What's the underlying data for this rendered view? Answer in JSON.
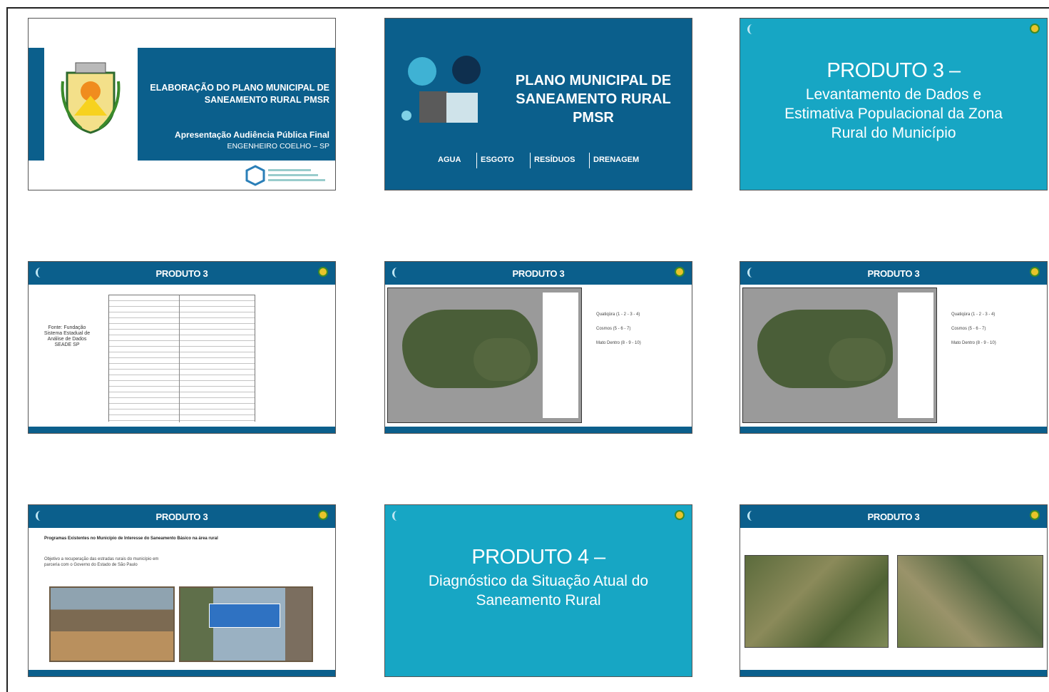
{
  "slides": {
    "s1": {
      "title": "ELABORAÇÃO DO PLANO MUNICIPAL DE SANEAMENTO RURAL PMSR",
      "subtitle": "Apresentação Audiência Pública Final",
      "place": "ENGENHEIRO COELHO – SP"
    },
    "s2": {
      "title_l1": "PLANO MUNICIPAL DE",
      "title_l2": "SANEAMENTO RURAL",
      "title_l3": "PMSR",
      "nav": [
        "AGUA",
        "ESGOTO",
        "RESÍDUOS",
        "DRENAGEM"
      ]
    },
    "s3": {
      "title": "PRODUTO 3 –",
      "line1": "Levantamento  de Dados e",
      "line2": "Estimativa  Populacional  da Zona",
      "line3": "Rural  do  Município"
    },
    "s4": {
      "header": "PRODUTO 3",
      "source": "Fonte: Fundação Sistema Estadual de Análise de Dados SEADE SP"
    },
    "s5": {
      "header": "PRODUTO 3",
      "bullets": [
        "Quatiqüra (1 - 2 - 3 - 4)",
        "Cosmos (5 - 6 - 7)",
        "Mato Dentro (8 - 9 - 10)"
      ]
    },
    "s6": {
      "header": "PRODUTO 3",
      "bullets": [
        "Quatiqüra (1 - 2 - 3 - 4)",
        "Cosmos (5 - 6 - 7)",
        "Mato Dentro (8 - 9 - 10)"
      ]
    },
    "s7": {
      "header": "PRODUTO 3",
      "heading": "Programas Existentes no Município de Interesse do Saneamento Básico na área rural",
      "bullet": "Objetivo a recuperação das estradas rurais do município em parceria com o Governo do Estado de São Paulo"
    },
    "s8": {
      "title": "PRODUTO 4 –",
      "line1": "Diagnóstico  da  Situação  Atual do",
      "line2": "Saneamento  Rural"
    },
    "s9": {
      "header": "PRODUTO 3"
    }
  }
}
